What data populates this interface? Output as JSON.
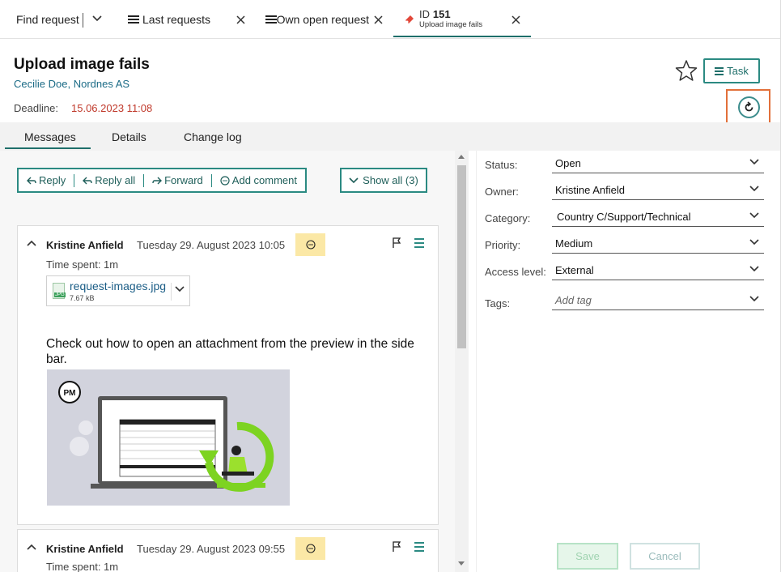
{
  "top_tabs": {
    "find_request": "Find request",
    "last_requests": "Last requests",
    "own_open_requests": "Own open request",
    "active_id_prefix": "ID",
    "active_id_number": "151",
    "active_subtitle": "Upload image fails"
  },
  "header": {
    "title": "Upload image fails",
    "subtitle": "Cecilie Doe, Nordnes AS",
    "deadline_label": "Deadline:",
    "deadline_value": "15.06.2023 11:08",
    "task_label": "Task"
  },
  "subtabs": [
    "Messages",
    "Details",
    "Change log"
  ],
  "toolbar": {
    "reply": "Reply",
    "reply_all": "Reply all",
    "forward": "Forward",
    "add_comment": "Add comment",
    "show_all": "Show all (3)"
  },
  "messages": [
    {
      "author": "Kristine Anfield",
      "date": "Tuesday 29. August 2023 10:05",
      "time_spent": "Time spent:  1m",
      "attachment_name": "request-images.jpg",
      "attachment_size": "7.67 kB",
      "attachment_ext": "JPG",
      "body": "Check out how to open an attachment from the preview in the side bar.",
      "preview_logo": "PM"
    },
    {
      "author": "Kristine Anfield",
      "date": "Tuesday 29. August 2023 09:55",
      "time_spent": "Time spent:  1m"
    }
  ],
  "details": {
    "status_label": "Status:",
    "status": "Open",
    "owner_label": "Owner:",
    "owner": "Kristine Anfield",
    "category_label": "Category:",
    "category": "Country C/Support/Technical",
    "priority_label": "Priority:",
    "priority": "Medium",
    "access_label": "Access level:",
    "access": "External",
    "tags_label": "Tags:",
    "tags_placeholder": "Add tag"
  },
  "actions": {
    "save": "Save",
    "cancel": "Cancel"
  },
  "colors": {
    "accent": "#2b8a82",
    "deadline": "#c0392b",
    "highlight": "#e2703a",
    "badge": "#fbe8a6"
  }
}
